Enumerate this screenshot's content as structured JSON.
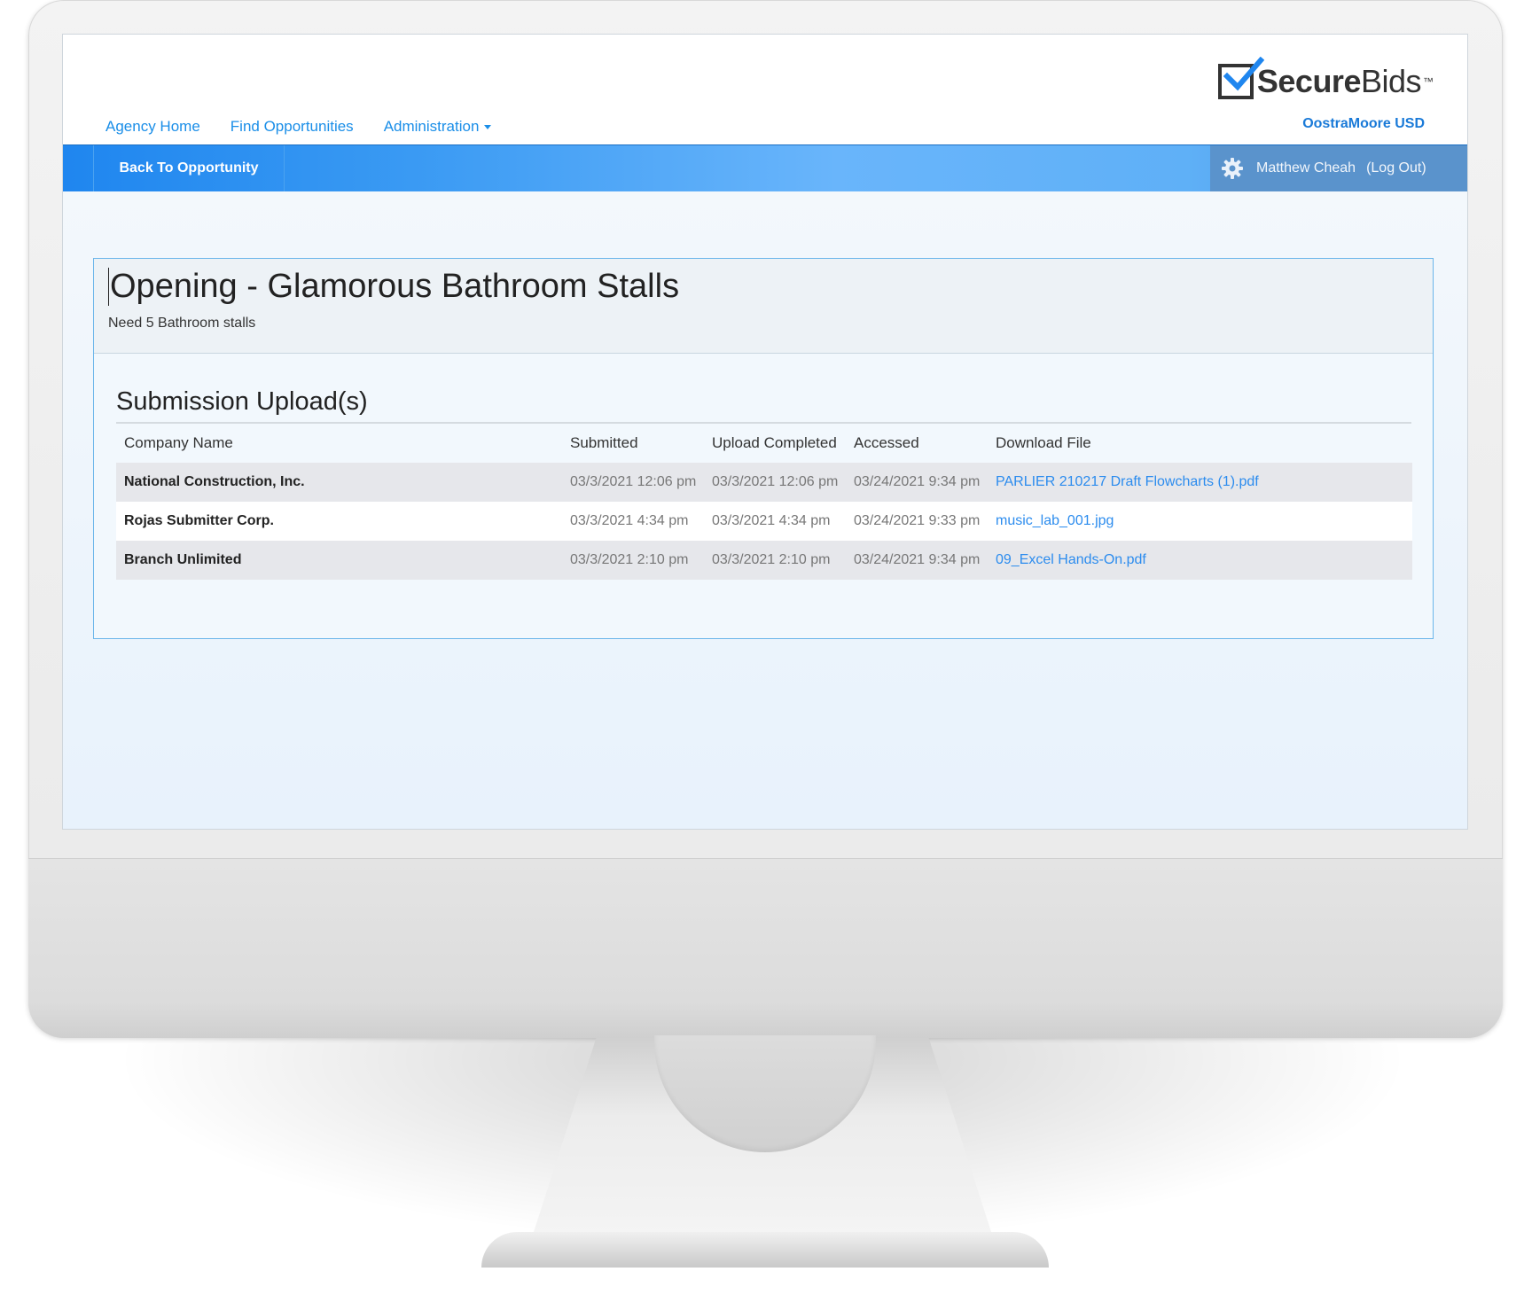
{
  "header": {
    "nav": {
      "agency_home": "Agency Home",
      "find_opportunities": "Find Opportunities",
      "administration": "Administration"
    },
    "logo": {
      "bold": "Secure",
      "light": "Bids",
      "tm": "™"
    },
    "agency_name": "OostraMoore USD"
  },
  "toolbar": {
    "back_label": "Back To Opportunity",
    "user_name": "Matthew Cheah",
    "logout_label": "(Log Out)"
  },
  "opening": {
    "title": "Opening - Glamorous Bathroom Stalls",
    "subtitle": "Need 5 Bathroom stalls"
  },
  "submissions": {
    "title": "Submission Upload(s)",
    "columns": [
      "Company Name",
      "Submitted",
      "Upload Completed",
      "Accessed",
      "Download File"
    ],
    "rows": [
      {
        "company": "National Construction, Inc.",
        "submitted": "03/3/2021 12:06 pm",
        "completed": "03/3/2021 12:06 pm",
        "accessed": "03/24/2021 9:34 pm",
        "file": "PARLIER 210217 Draft Flowcharts (1).pdf"
      },
      {
        "company": "Rojas Submitter Corp.",
        "submitted": "03/3/2021 4:34 pm",
        "completed": "03/3/2021 4:34 pm",
        "accessed": "03/24/2021 9:33 pm",
        "file": "music_lab_001.jpg"
      },
      {
        "company": "Branch Unlimited",
        "submitted": "03/3/2021 2:10 pm",
        "completed": "03/3/2021 2:10 pm",
        "accessed": "03/24/2021 9:34 pm",
        "file": "09_Excel Hands-On.pdf"
      }
    ]
  },
  "icons": {
    "gear": "gear-icon",
    "logo": "checkbox-logo-icon",
    "caret": "caret-down-icon"
  },
  "colors": {
    "accent": "#1a8ee8",
    "toolbar": "#3a9af3",
    "link": "#2c8cee"
  }
}
